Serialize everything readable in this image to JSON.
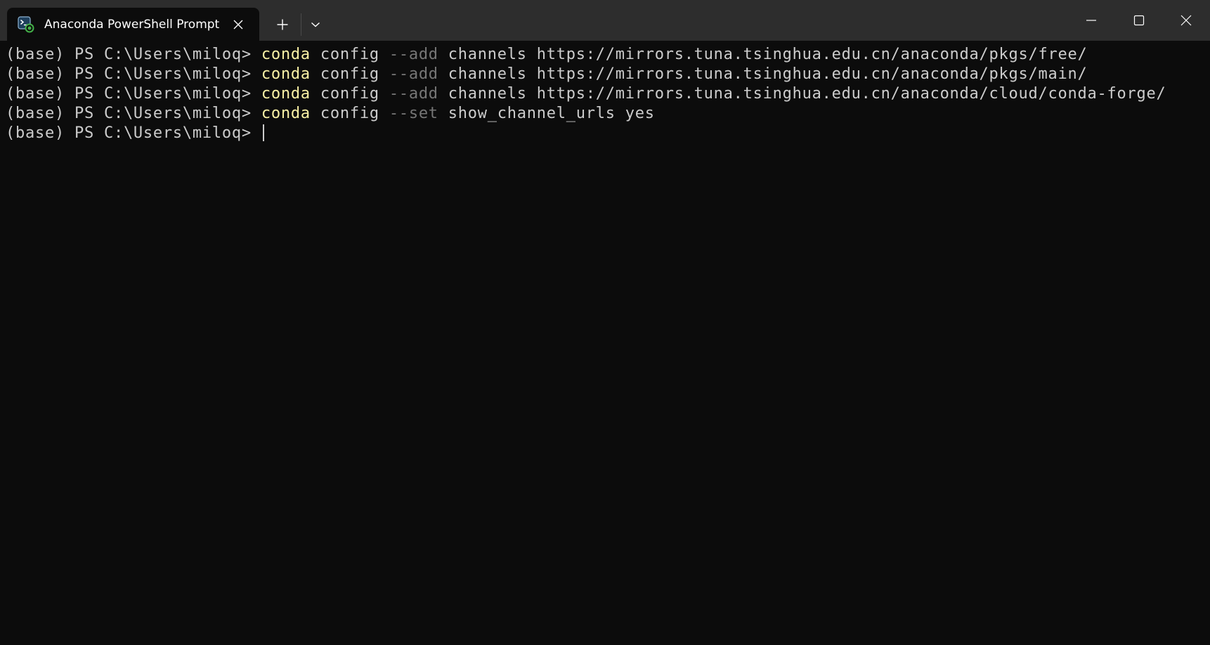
{
  "window": {
    "tab_title": "Anaconda PowerShell Prompt",
    "tab_icon": "powershell-icon",
    "new_tab_icon": "plus-icon",
    "dropdown_icon": "chevron-down-icon",
    "minimize_icon": "minimize-icon",
    "maximize_icon": "maximize-icon",
    "close_icon": "close-icon"
  },
  "colors": {
    "terminal_bg": "#0c0c0c",
    "titlebar_bg": "#2d2d2d",
    "command": "#f9f1a5",
    "parameter": "#767676",
    "text": "#cccccc"
  },
  "terminal": {
    "lines": [
      {
        "prompt": "(base) PS C:\\Users\\miloq> ",
        "command": "conda",
        "arg1": " config ",
        "param": "--add",
        "rest": " channels https://mirrors.tuna.tsinghua.edu.cn/anaconda/pkgs/free/"
      },
      {
        "prompt": "(base) PS C:\\Users\\miloq> ",
        "command": "conda",
        "arg1": " config ",
        "param": "--add",
        "rest": " channels https://mirrors.tuna.tsinghua.edu.cn/anaconda/pkgs/main/"
      },
      {
        "prompt": "(base) PS C:\\Users\\miloq> ",
        "command": "conda",
        "arg1": " config ",
        "param": "--add",
        "rest": " channels https://mirrors.tuna.tsinghua.edu.cn/anaconda/cloud/conda-forge/"
      },
      {
        "prompt": "(base) PS C:\\Users\\miloq> ",
        "command": "conda",
        "arg1": " config ",
        "param": "--set",
        "rest": " show_channel_urls yes"
      }
    ],
    "current_prompt": "(base) PS C:\\Users\\miloq> "
  }
}
